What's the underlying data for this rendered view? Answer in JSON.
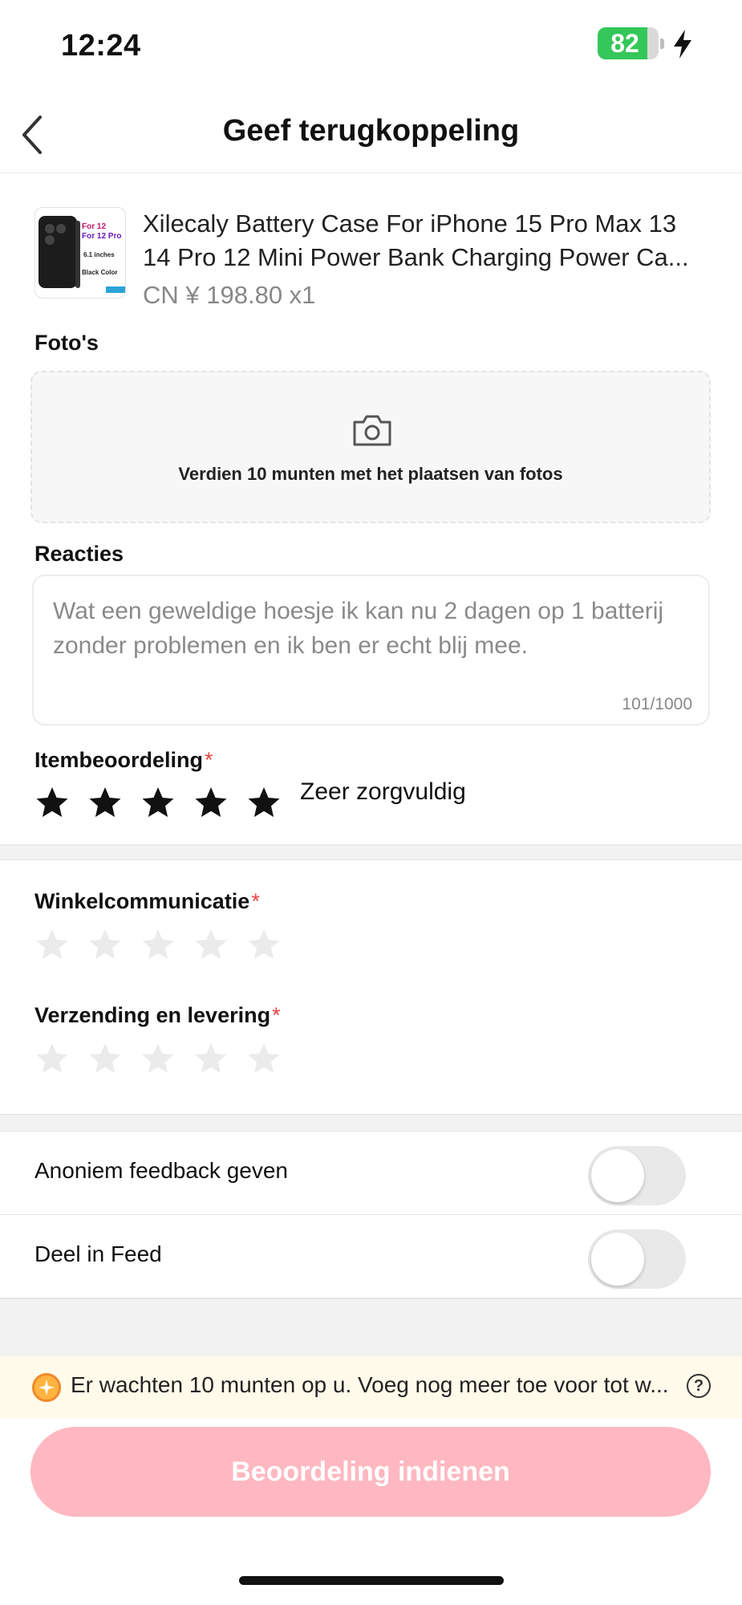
{
  "status_bar": {
    "time": "12:24",
    "battery": "82",
    "battery_level": 0.82,
    "battery_color": "#34c759"
  },
  "header": {
    "title": "Geef terugkoppeling",
    "back_icon": "chevron-left-icon"
  },
  "product": {
    "title_line1": "Xilecaly Battery Case For iPhone 15 Pro Max 13",
    "title_line2": "14 Pro 12 Mini Power Bank Charging Power Ca...",
    "price": "CN ¥ 198.80 x1",
    "thumb_text": [
      "For 12",
      "For 12 Pro",
      "6.1 inches",
      "Black Color"
    ]
  },
  "photos": {
    "label": "Foto's",
    "prompt": "Verdien 10 munten met het plaatsen van fotos",
    "icon": "camera-icon"
  },
  "reviews": {
    "label": "Reacties",
    "value": "Wat een geweldige hoesje ik kan nu 2 dagen op 1 batterij zonder problemen en ik ben er echt blij mee.",
    "counter": "101/1000"
  },
  "item_rating": {
    "label": "Itembeoordeling",
    "required_mark": "*",
    "stars": 5,
    "max": 5,
    "text": "Zeer zorgvuldig"
  },
  "shop_communication": {
    "label": "Winkelcommunicatie",
    "required_mark": "*",
    "stars": 0,
    "max": 5
  },
  "shipping": {
    "label": "Verzending en levering",
    "required_mark": "*",
    "stars": 0,
    "max": 5
  },
  "toggles": [
    {
      "label": "Anoniem feedback geven",
      "on": false
    },
    {
      "label": "Deel in Feed",
      "on": false
    }
  ],
  "coin_banner": {
    "text": "Er wachten 10 munten op u. Voeg nog meer toe voor tot w...",
    "help": "?"
  },
  "submit": {
    "label": "Beoordeling indienen",
    "color": "#ffb8c1"
  },
  "colors": {
    "star_filled": "#111111",
    "star_empty": "#ebebeb",
    "required": "#e84545"
  }
}
